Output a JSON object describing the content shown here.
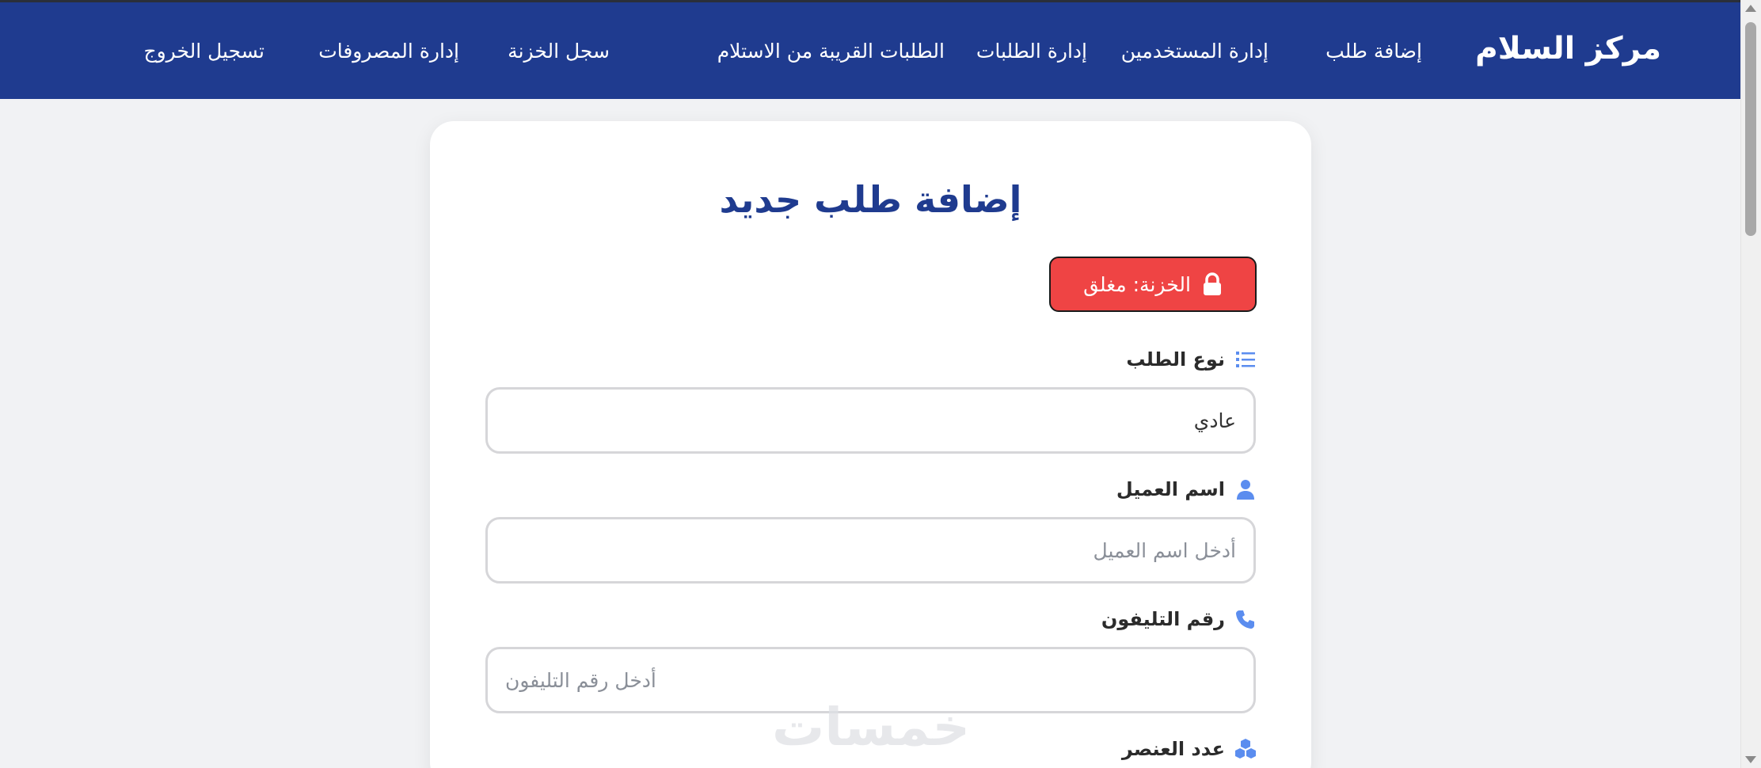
{
  "app": {
    "brand": "مركز السلام"
  },
  "nav": {
    "items": [
      {
        "label": "إضافة طلب"
      },
      {
        "label": "إدارة المستخدمين"
      },
      {
        "label": "إدارة الطلبات"
      },
      {
        "label": "الطلبات القريبة من الاستلام"
      },
      {
        "label": "سجل الخزنة"
      },
      {
        "label": "إدارة المصروفات"
      },
      {
        "label": "تسجيل الخروج"
      }
    ]
  },
  "page": {
    "title": "إضافة طلب جديد"
  },
  "safe_status": {
    "label": "الخزنة: مغلق",
    "icon": "lock-icon",
    "color": "#ef4444"
  },
  "form": {
    "order_type": {
      "label": "نوع الطلب",
      "icon": "list-icon",
      "value": "عادي"
    },
    "customer_name": {
      "label": "اسم العميل",
      "icon": "user-icon",
      "placeholder": "أدخل اسم العميل"
    },
    "phone": {
      "label": "رقم التليفون",
      "icon": "phone-icon",
      "placeholder": "أدخل رقم التليفون"
    },
    "item_count": {
      "label": "عدد العنصر",
      "icon": "cubes-icon"
    }
  },
  "watermark": {
    "text": "خمسات"
  },
  "colors": {
    "nav_bg": "#1f3b8f",
    "accent": "#1f3b8f",
    "icon_blue": "#5b8def",
    "badge_red": "#ef4444"
  }
}
